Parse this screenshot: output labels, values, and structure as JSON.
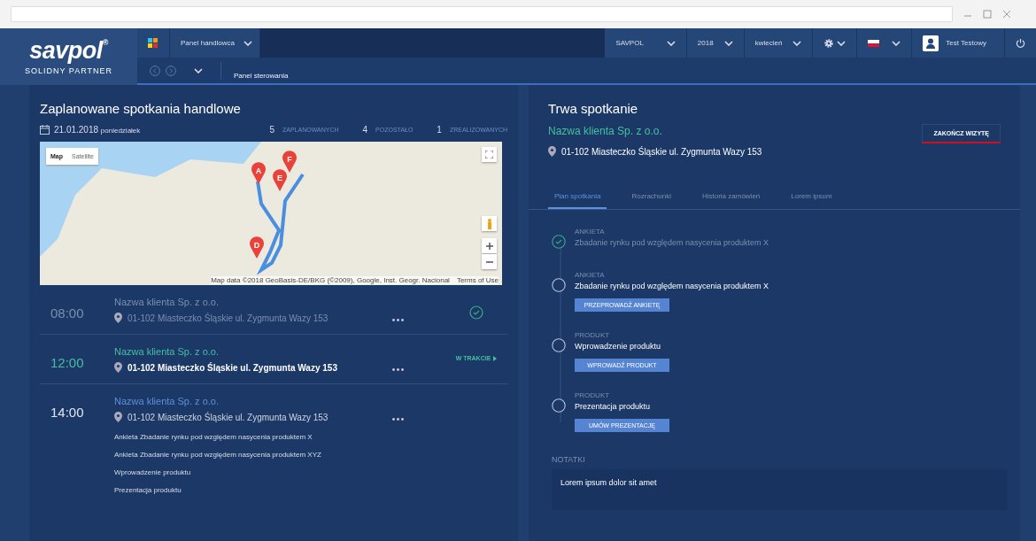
{
  "logo": {
    "name": "savpol",
    "mark": "®",
    "tagline": "SOLIDNY PARTNER"
  },
  "topbar": {
    "module": "Panel handlowca",
    "selectors": [
      "SAVPOL",
      "2018",
      "kwiecień"
    ],
    "user": "Test Testowy"
  },
  "breadcrumb": "Panel sterowania",
  "schedule": {
    "title": "Zaplanowane spotkania handlowe",
    "date": "21.01.2018",
    "weekday": "poniedziałek",
    "stats": [
      {
        "count": "5",
        "label": "ZAPLANOWANYCH"
      },
      {
        "count": "4",
        "label": "POZOSTAŁO"
      },
      {
        "count": "1",
        "label": "ZREALIZOWANYCH"
      }
    ],
    "map": {
      "modes": [
        {
          "label": "Map",
          "selected": true
        },
        {
          "label": "Satellite",
          "selected": false
        }
      ],
      "markers": [
        "A",
        "F",
        "E",
        "D"
      ],
      "attribution": "Map data ©2018 GeoBasis-DE/BKG (©2009), Google, Inst. Geogr. Nacional",
      "terms": "Terms of Use"
    },
    "meetings": [
      {
        "time": "08:00",
        "client": "Nazwa klienta Sp. z o.o.",
        "address": "01-102 Miasteczko Śląskie ul. Zygmunta Wazy 153",
        "kind": "done"
      },
      {
        "time": "12:00",
        "client": "Nazwa klienta Sp. z o.o.",
        "address": "01-102 Miasteczko Śląskie ul. Zygmunta Wazy 153",
        "kind": "current",
        "status_label": "W TRAKCIE"
      },
      {
        "time": "14:00",
        "client": "Nazwa klienta Sp. z o.o.",
        "address": "01-102 Miasteczko Śląskie ul. Zygmunta Wazy 153",
        "kind": "planned",
        "items": [
          "Ankieta Zbadanie rynku pod względem nasycenia produktem X",
          "Ankieta Zbadanie rynku pod względem nasycenia produktem XYZ",
          "Wprowadzenie produktu",
          "Prezentacja produktu"
        ]
      }
    ]
  },
  "current": {
    "title": "Trwa spotkanie",
    "client": "Nazwa klienta Sp. z o.o.",
    "address": "01-102 Miasteczko Śląskie ul. Zygmunta Wazy 153",
    "end_button": "ZAKOŃCZ WIZYTĘ",
    "tabs": [
      {
        "label": "Plan spotkania",
        "selected": true
      },
      {
        "label": "Rozrachunki",
        "selected": false
      },
      {
        "label": "Historia zamówień",
        "selected": false
      },
      {
        "label": "Lorem ipsum",
        "selected": false
      }
    ],
    "steps": [
      {
        "category": "ANKIETA",
        "title": "Zbadanie rynku pod względem nasycenia produktem X",
        "done": true
      },
      {
        "category": "ANKIETA",
        "title": "Zbadanie rynku pod względem nasycenia produktem X",
        "done": false,
        "action": "PRZEPROWADŹ ANKIETĘ"
      },
      {
        "category": "PRODUKT",
        "title": "Wprowadzenie produktu",
        "done": false,
        "action": "WPROWADŹ PRODUKT"
      },
      {
        "category": "PRODUKT",
        "title": "Prezentacja produktu",
        "done": false,
        "action": "UMÓW PREZENTACJĘ"
      }
    ],
    "notes": {
      "label": "NOTATKI",
      "value": "Lorem ipsum dolor sit amet"
    }
  }
}
